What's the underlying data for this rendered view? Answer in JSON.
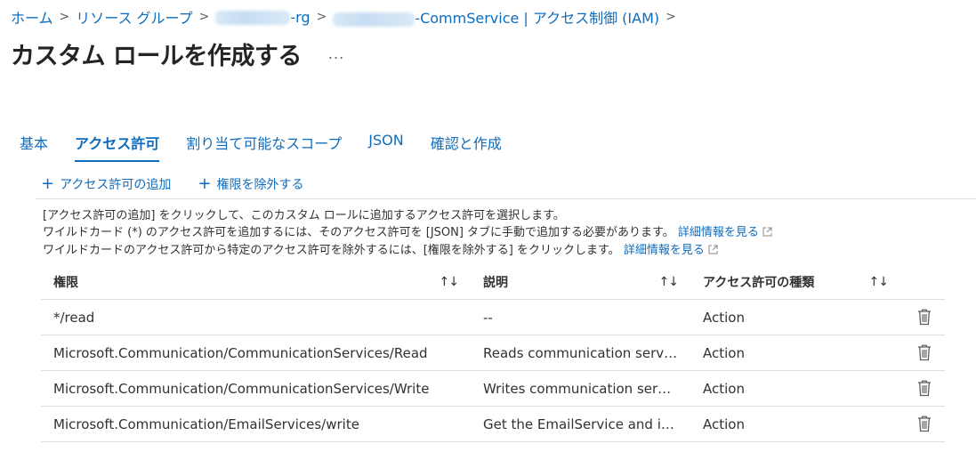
{
  "breadcrumb": {
    "home": "ホーム",
    "resource_groups": "リソース グループ",
    "rg_suffix": "-rg",
    "resource_suffix": "-CommService | アクセス制御 (IAM)",
    "separator": ">"
  },
  "page": {
    "title": "カスタム ロールを作成する",
    "more": "..."
  },
  "tabs": [
    {
      "label": "基本",
      "active": false
    },
    {
      "label": "アクセス許可",
      "active": true
    },
    {
      "label": "割り当て可能なスコープ",
      "active": false
    },
    {
      "label": "JSON",
      "active": false
    },
    {
      "label": "確認と作成",
      "active": false
    }
  ],
  "toolbar": {
    "add_permission": "アクセス許可の追加",
    "exclude_permission": "権限を除外する"
  },
  "description": {
    "line1": "[アクセス許可の追加] をクリックして、このカスタム ロールに追加するアクセス許可を選択します。",
    "line2": "ワイルドカード (*) のアクセス許可を追加するには、そのアクセス許可を [JSON] タブに手動で追加する必要があります。",
    "line2_link": "詳細情報を見る",
    "line3": "ワイルドカードのアクセス許可から特定のアクセス許可を除外するには、[権限を除外する] をクリックします。",
    "line3_link": "詳細情報を見る"
  },
  "table": {
    "headers": {
      "permission": "権限",
      "description": "説明",
      "type": "アクセス許可の種類",
      "sort": "↑↓"
    },
    "rows": [
      {
        "permission": "*/read",
        "description": "--",
        "type": "Action"
      },
      {
        "permission": "Microsoft.Communication/CommunicationServices/Read",
        "description": "Reads communication servi…",
        "type": "Action"
      },
      {
        "permission": "Microsoft.Communication/CommunicationServices/Write",
        "description": "Writes communication serv…",
        "type": "Action"
      },
      {
        "permission": "Microsoft.Communication/EmailServices/write",
        "description": "Get the EmailService and it…",
        "type": "Action"
      }
    ]
  },
  "colors": {
    "accent": "#0f6cbd",
    "text": "#323130",
    "divider": "#e1dfdd"
  }
}
